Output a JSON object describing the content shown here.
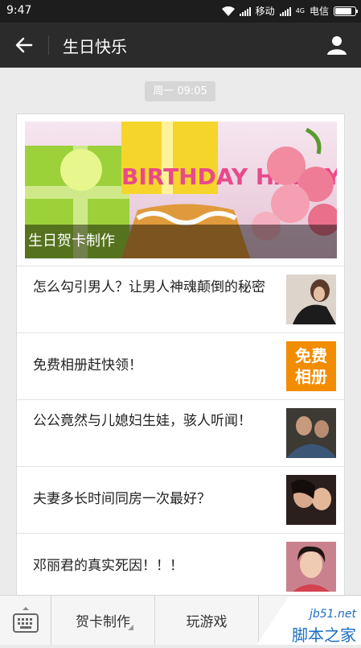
{
  "status_bar": {
    "time": "9:47",
    "carrier1": "移动",
    "carrier2": "电信",
    "network": "4G",
    "battery_level": 0.85
  },
  "header": {
    "title": "生日快乐"
  },
  "timestamp": "周一 09:05",
  "banner": {
    "caption": "生日贺卡制作",
    "art_text": "BIRTHDAY HAPPY"
  },
  "articles": [
    {
      "title": "怎么勾引男人？让男人神魂颠倒的秘密"
    },
    {
      "title": "免费相册赶快领！",
      "thumb_text": "免费相册"
    },
    {
      "title": "公公竟然与儿媳妇生娃，骇人听闻！"
    },
    {
      "title": "夫妻多长时间同房一次最好？"
    },
    {
      "title": "邓丽君的真实死因！！！"
    }
  ],
  "bottom_menu": [
    {
      "label": "贺卡制作"
    },
    {
      "label": "玩游戏"
    }
  ],
  "watermark": {
    "site": "jb51.net",
    "name": "脚本之家"
  },
  "colors": {
    "header_bg": "#2b2b2b",
    "status_bg": "#1d1d1d",
    "page_bg": "#ebebeb",
    "thumb_orange": "#f28c00"
  }
}
